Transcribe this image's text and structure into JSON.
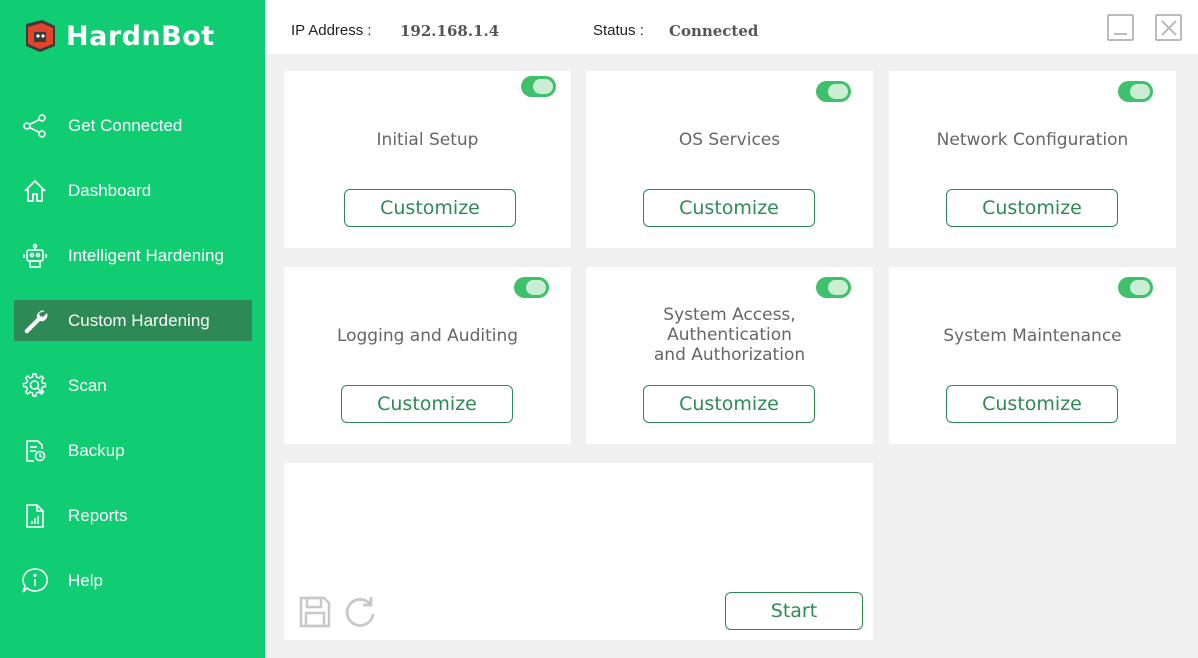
{
  "app": {
    "name": "HardnBot"
  },
  "nav": [
    {
      "id": "get-connected",
      "label": "Get Connected",
      "icon": "share-nodes-icon",
      "active": false
    },
    {
      "id": "dashboard",
      "label": "Dashboard",
      "icon": "home-icon",
      "active": false
    },
    {
      "id": "intelligent-hardening",
      "label": "Intelligent Hardening",
      "icon": "robot-icon",
      "active": false
    },
    {
      "id": "custom-hardening",
      "label": "Custom Hardening",
      "icon": "wrench-icon",
      "active": true
    },
    {
      "id": "scan",
      "label": "Scan",
      "icon": "gear-scan-icon",
      "active": false
    },
    {
      "id": "backup",
      "label": "Backup",
      "icon": "backup-icon",
      "active": false
    },
    {
      "id": "reports",
      "label": "Reports",
      "icon": "report-icon",
      "active": false
    },
    {
      "id": "help",
      "label": "Help",
      "icon": "info-icon",
      "active": false
    }
  ],
  "header": {
    "ip_label": "IP Address :",
    "ip_value": "192.168.1.4",
    "status_label": "Status :",
    "status_value": "Connected"
  },
  "cards": [
    {
      "title": "Initial Setup",
      "enabled": true,
      "button": "Customize"
    },
    {
      "title": "OS Services",
      "enabled": true,
      "button": "Customize"
    },
    {
      "title": "Network Configuration",
      "enabled": true,
      "button": "Customize"
    },
    {
      "title": "Logging and Auditing",
      "enabled": true,
      "button": "Customize"
    },
    {
      "title_lines": [
        "System Access,",
        "Authentication",
        "and Authorization"
      ],
      "enabled": true,
      "button": "Customize"
    },
    {
      "title": "System Maintenance",
      "enabled": true,
      "button": "Customize"
    }
  ],
  "action_panel": {
    "start_label": "Start"
  },
  "colors": {
    "sidebar": "#10cc72",
    "active_item": "#2e8a55",
    "accent": "#2e8a55",
    "toggle_on": "#3fc06b"
  }
}
